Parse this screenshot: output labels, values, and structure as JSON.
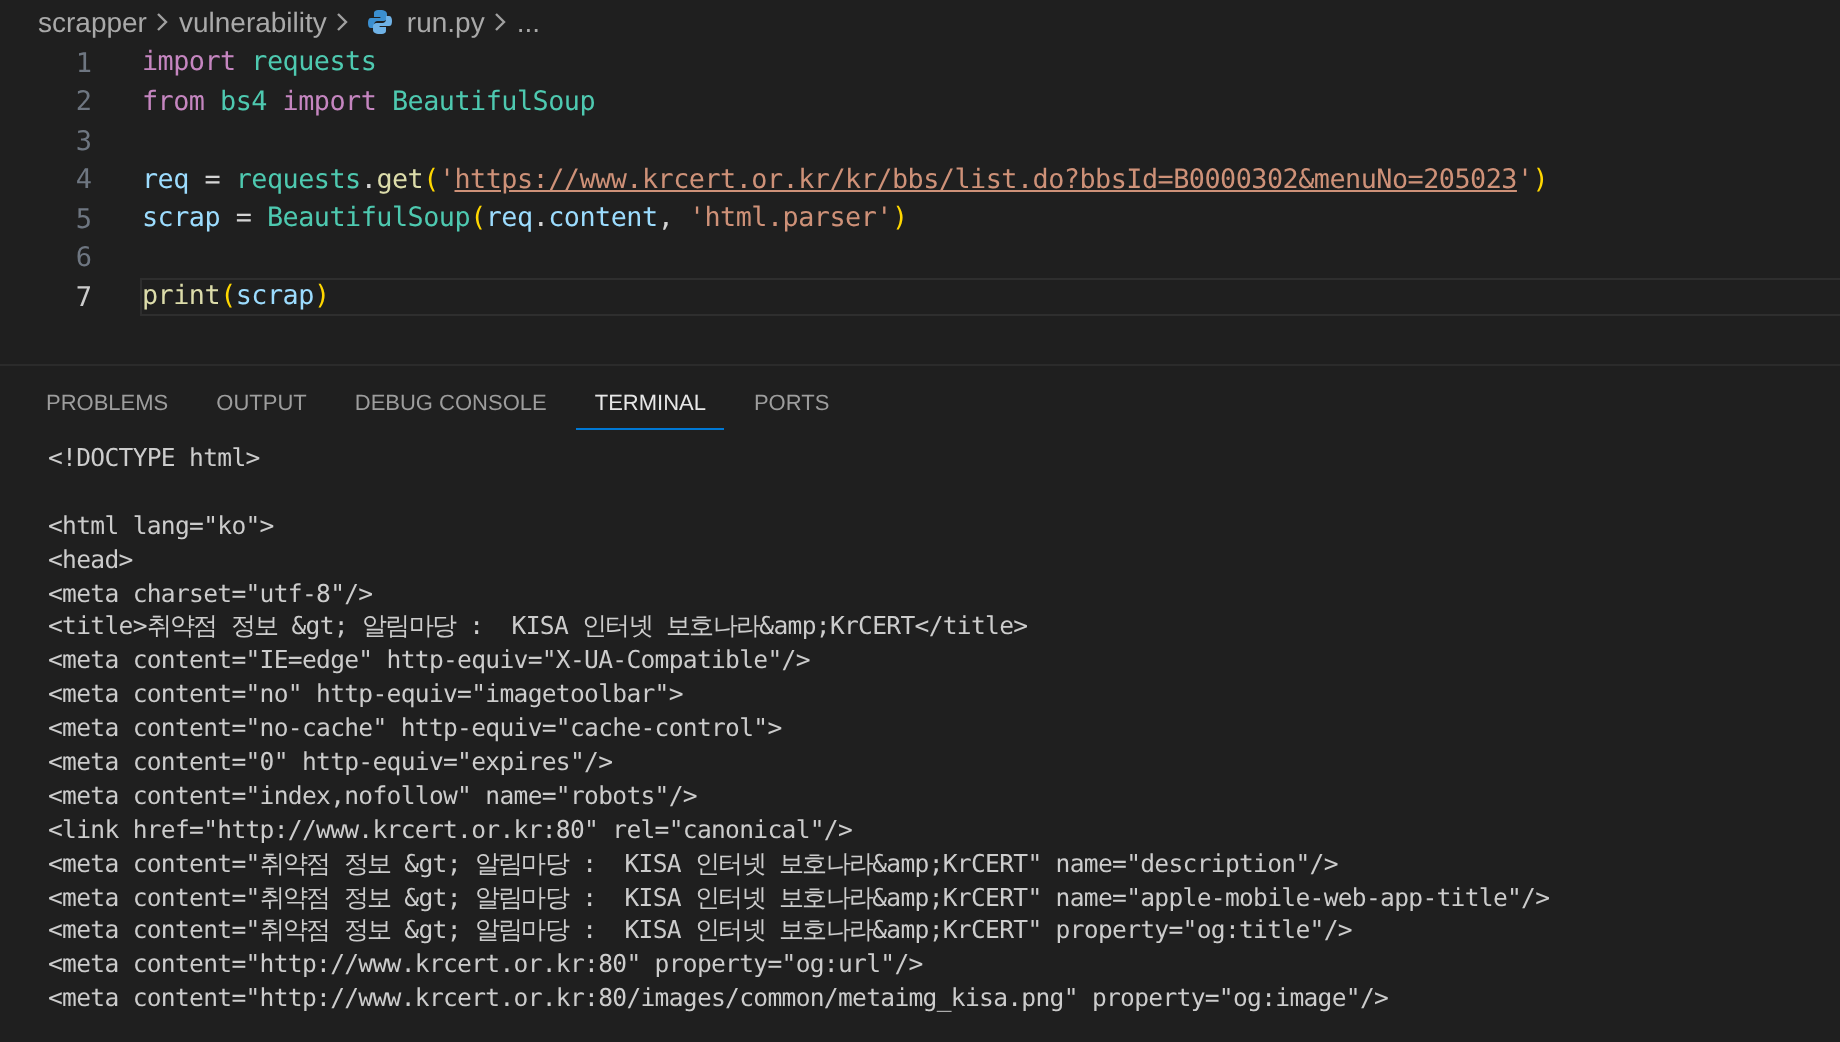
{
  "breadcrumb": [
    {
      "label": "scrapper",
      "kind": "folder"
    },
    {
      "label": "vulnerability",
      "kind": "folder"
    },
    {
      "label": "run.py",
      "kind": "python-file"
    },
    {
      "label": "...",
      "kind": "more"
    }
  ],
  "editor": {
    "lines": [
      {
        "number": "1",
        "active": false,
        "tokens": [
          {
            "text": "import",
            "kind": "keyword"
          },
          {
            "text": " requests",
            "kind": "module"
          }
        ]
      },
      {
        "number": "2",
        "active": false,
        "tokens": [
          {
            "text": "from",
            "kind": "keyword"
          },
          {
            "text": " bs4",
            "kind": "module"
          },
          {
            "text": " import",
            "kind": "keyword"
          },
          {
            "text": " BeautifulSoup",
            "kind": "module"
          }
        ]
      },
      {
        "number": "3",
        "active": false
      },
      {
        "number": "4",
        "active": false,
        "tokens": [
          {
            "text": "req",
            "kind": "variable"
          },
          {
            "text": " = ",
            "kind": "plain"
          },
          {
            "text": "requests",
            "kind": "module"
          },
          {
            "text": ".",
            "kind": "plain"
          },
          {
            "text": "get",
            "kind": "function"
          },
          {
            "text": "(",
            "kind": "bracket"
          },
          {
            "text": "'",
            "kind": "string"
          },
          {
            "text": "https://www.krcert.or.kr/kr/bbs/list.do?bbsId=B0000302&menuNo=205023",
            "kind": "link"
          },
          {
            "text": "'",
            "kind": "string"
          },
          {
            "text": ")",
            "kind": "bracket"
          }
        ]
      },
      {
        "number": "5",
        "active": false,
        "tokens": [
          {
            "text": "scrap",
            "kind": "variable"
          },
          {
            "text": " = ",
            "kind": "plain"
          },
          {
            "text": "BeautifulSoup",
            "kind": "module"
          },
          {
            "text": "(",
            "kind": "bracket"
          },
          {
            "text": "req",
            "kind": "variable"
          },
          {
            "text": ".",
            "kind": "plain"
          },
          {
            "text": "content",
            "kind": "variable"
          },
          {
            "text": ", ",
            "kind": "plain"
          },
          {
            "text": "'html.parser'",
            "kind": "string"
          },
          {
            "text": ")",
            "kind": "bracket"
          }
        ]
      },
      {
        "number": "6",
        "active": false
      },
      {
        "number": "7",
        "active": true,
        "tokens": [
          {
            "text": "print",
            "kind": "function"
          },
          {
            "text": "(",
            "kind": "bracket"
          },
          {
            "text": "scrap",
            "kind": "variable"
          },
          {
            "text": ")",
            "kind": "bracket"
          }
        ]
      }
    ]
  },
  "panel": {
    "tabs": [
      {
        "label": "PROBLEMS",
        "selected": false
      },
      {
        "label": "OUTPUT",
        "selected": false
      },
      {
        "label": "DEBUG CONSOLE",
        "selected": false
      },
      {
        "label": "TERMINAL",
        "selected": true
      },
      {
        "label": "PORTS",
        "selected": false
      }
    ],
    "terminal_lines": [
      {
        "text": "<!DOCTYPE html>",
        "blank_before": false
      },
      {
        "text": "<html lang=\"ko\">",
        "blank_before": true
      },
      {
        "text": "<head>",
        "blank_before": false
      },
      {
        "text": "<meta charset=\"utf-8\"/>",
        "blank_before": false
      },
      {
        "text": "<title>취약점 정보 &gt; 알림마당 :  KISA 인터넷 보호나라&amp;KrCERT</title>",
        "blank_before": false
      },
      {
        "text": "<meta content=\"IE=edge\" http-equiv=\"X-UA-Compatible\"/>",
        "blank_before": false
      },
      {
        "text": "<meta content=\"no\" http-equiv=\"imagetoolbar\">",
        "blank_before": false
      },
      {
        "text": "<meta content=\"no-cache\" http-equiv=\"cache-control\">",
        "blank_before": false
      },
      {
        "text": "<meta content=\"0\" http-equiv=\"expires\"/>",
        "blank_before": false
      },
      {
        "text": "<meta content=\"index,nofollow\" name=\"robots\"/>",
        "blank_before": false
      },
      {
        "text": "<link href=\"http://www.krcert.or.kr:80\" rel=\"canonical\"/>",
        "blank_before": false
      },
      {
        "text": "<meta content=\"취약점 정보 &gt; 알림마당 :  KISA 인터넷 보호나라&amp;KrCERT\" name=\"description\"/>",
        "blank_before": false
      },
      {
        "text": "<meta content=\"취약점 정보 &gt; 알림마당 :  KISA 인터넷 보호나라&amp;KrCERT\" name=\"apple-mobile-web-app-title\"/>",
        "blank_before": false
      },
      {
        "text": "<meta content=\"취약점 정보 &gt; 알림마당 :  KISA 인터넷 보호나라&amp;KrCERT\" property=\"og:title\"/>",
        "blank_before": false
      },
      {
        "text": "<meta content=\"http://www.krcert.or.kr:80\" property=\"og:url\"/>",
        "blank_before": false
      },
      {
        "text": "<meta content=\"http://www.krcert.or.kr:80/images/common/metaimg_kisa.png\" property=\"og:image\"/>",
        "blank_before": false
      }
    ]
  }
}
